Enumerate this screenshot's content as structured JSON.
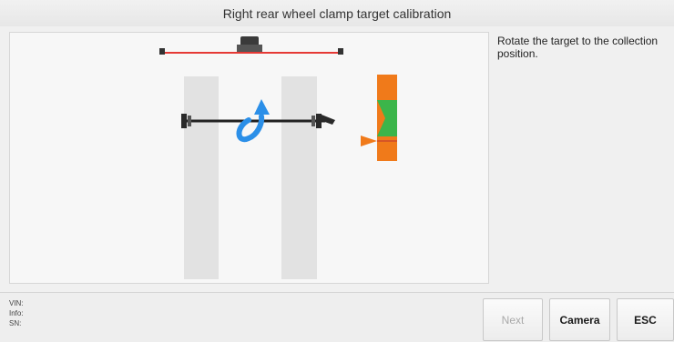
{
  "header": {
    "title": "Right rear wheel clamp target calibration"
  },
  "instructions": {
    "text": "Rotate the target to the collection position."
  },
  "vehicle_info": {
    "vin_label": "VIN:",
    "info_label": "Info:",
    "sn_label": "SN:"
  },
  "buttons": {
    "next_label": "Next",
    "camera_label": "Camera",
    "esc_label": "ESC"
  },
  "colors": {
    "accent_orange": "#f07a1a",
    "accent_green": "#3bb54a",
    "rotation_arrow": "#2b8fe8",
    "reference_line": "#e53935"
  },
  "icons": {
    "rotation": "rotate-arrow-icon",
    "indicator": "collection-position-indicator-icon"
  }
}
